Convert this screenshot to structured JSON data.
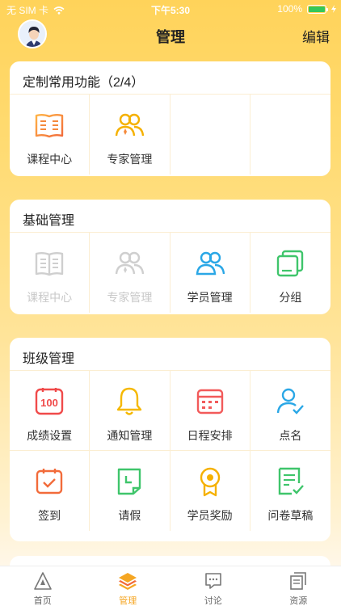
{
  "status_bar": {
    "carrier": "无 SIM 卡",
    "time": "下午5:30",
    "battery": "100%"
  },
  "header": {
    "title": "管理",
    "edit_label": "编辑"
  },
  "custom_section": {
    "title": "定制常用功能（2/4）",
    "items": [
      {
        "label": "课程中心",
        "icon": "book-icon"
      },
      {
        "label": "专家管理",
        "icon": "experts-icon"
      }
    ]
  },
  "basic_section": {
    "title": "基础管理",
    "items": [
      {
        "label": "课程中心",
        "icon": "book-icon",
        "disabled": true
      },
      {
        "label": "专家管理",
        "icon": "experts-icon",
        "disabled": true
      },
      {
        "label": "学员管理",
        "icon": "students-icon"
      },
      {
        "label": "分组",
        "icon": "group-icon"
      }
    ]
  },
  "class_section": {
    "title": "班级管理",
    "items": [
      {
        "label": "成绩设置",
        "icon": "score-icon"
      },
      {
        "label": "通知管理",
        "icon": "bell-icon"
      },
      {
        "label": "日程安排",
        "icon": "calendar-icon"
      },
      {
        "label": "点名",
        "icon": "roll-call-icon"
      },
      {
        "label": "签到",
        "icon": "checkin-icon"
      },
      {
        "label": "请假",
        "icon": "leave-icon"
      },
      {
        "label": "学员奖励",
        "icon": "award-icon"
      },
      {
        "label": "问卷草稿",
        "icon": "survey-icon"
      }
    ]
  },
  "tab_bar": {
    "tabs": [
      {
        "label": "首页",
        "icon": "home-icon"
      },
      {
        "label": "管理",
        "icon": "layers-icon",
        "active": true
      },
      {
        "label": "讨论",
        "icon": "discuss-icon"
      },
      {
        "label": "资源",
        "icon": "resources-icon"
      }
    ]
  },
  "colors": {
    "accent": "#f5a623",
    "background": "#ffd35a",
    "disabled": "#c8c8c8"
  }
}
